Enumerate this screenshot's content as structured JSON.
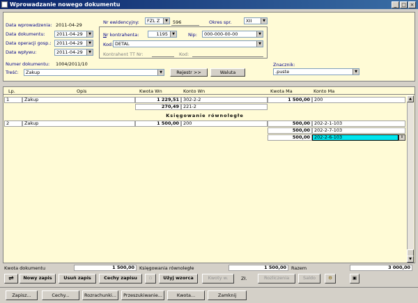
{
  "window": {
    "title": "Wprowadzanie nowego dokumentu"
  },
  "header": {
    "data_wprowadzenia_label": "Data wprowadzenia:",
    "data_wprowadzenia": "2011-04-29",
    "data_dokumentu_label": "Data dokumentu:",
    "data_dokumentu": "2011-04-29",
    "data_operacji_label": "Data operacji gosp.:",
    "data_operacji": "2011-04-29",
    "data_wplywu_label": "Data wpływu:",
    "data_wplywu": "2011-04-29",
    "numer_dokumentu_label": "Numer dokumentu:",
    "numer_dokumentu": "1004/2011/10",
    "tresc_label": "Treść:",
    "tresc": "Zakup",
    "nr_ewidencyjny_label": "Nr ewidencyjny:",
    "nr_ewidencyjny_code": "FZL Z",
    "nr_ewidencyjny_num": "596",
    "okres_label": "Okres spr.",
    "okres": "XII",
    "nr_kontrahenta_label": "Nr kontrahenta:",
    "nr_kontrahenta": "1195",
    "nip_label": "Nip:",
    "nip": "000-000-00-00",
    "kod_label": "Kod:",
    "kod": "DETAL",
    "kontrahent_tt_label": "Kontrahent TT Nr:",
    "kod2_label": "Kod:",
    "rejestr_button": "Rejestr >>",
    "waluta_button": "Waluta",
    "znacznik_label": "Znacznik:",
    "znacznik": ".puste"
  },
  "grid": {
    "columns": {
      "lp": "Lp.",
      "opis": "Opis",
      "kwota_wn": "Kwota  Wn",
      "konto_wn": "Konto  Wn",
      "kwota_ma": "Kwota Ma",
      "konto_ma": "Konto Ma"
    },
    "row1": {
      "lp": "1",
      "opis": "Zakup",
      "kwota_wn": "1 229,51",
      "konto_wn": "302-2-2",
      "kwota_ma": "1 500,00",
      "konto_ma": "200"
    },
    "row1b": {
      "kwota_wn": "270,49",
      "konto_wn": "221-2"
    },
    "section_title": "Księgowanie równoległe",
    "row2": {
      "lp": "2",
      "opis": "Zakup",
      "kwota_wn": "1 500,00",
      "konto_wn": "200"
    },
    "row2_ma": [
      {
        "kwota": "500,00",
        "konto": "202-2-1-103"
      },
      {
        "kwota": "500,00",
        "konto": "202-2-7-103"
      },
      {
        "kwota": "500,00",
        "konto": "202-2-6-103"
      }
    ]
  },
  "totals": {
    "kwota_dokumentu_label": "Kwota dokumentu",
    "kwota_dokumentu": "1 500,00",
    "ksiegowania_label": "Księgowania równoległe",
    "ksiegowania": "1 500,00",
    "razem_label": "Razem",
    "razem": "3 000,00"
  },
  "toolbar": {
    "nowy_zapis": "Nowy zapis",
    "usun_zapis": "Usuń zapis",
    "cechy_zapisu": "Cechy zapisu",
    "uzyj_wzorca": "Użyj wzorca",
    "kwoty_w": "Kwoty w.",
    "zl": "Zł.",
    "rozliczenia": "Rozliczenia",
    "saldo": "Saldo"
  },
  "footer": {
    "zapisz": "Zapisz...",
    "cechy": "Cechy...",
    "rozrachunki": "Rozrachunki...",
    "przeszukiwanie": "Przeszukiwanie...",
    "kwota": "Kwota...",
    "zamknij": "Zamknij"
  },
  "colors": {
    "panel_bg": "#fffbd6",
    "selected_cell": "#00e5ee",
    "title_bar": "#0a246a"
  }
}
